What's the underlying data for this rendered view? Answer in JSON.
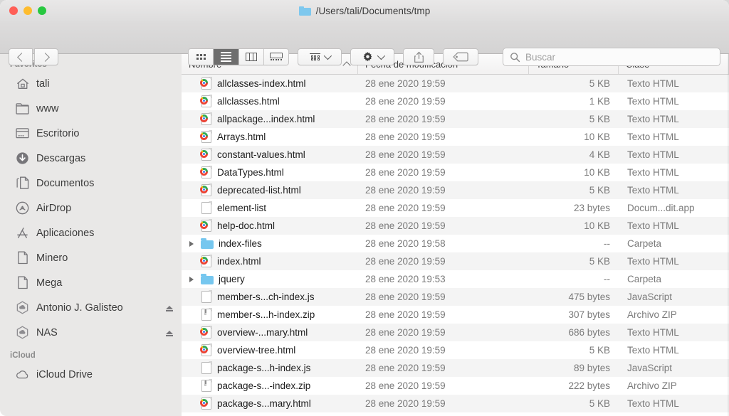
{
  "window": {
    "title": "/Users/tali/Documents/tmp",
    "folder_icon": "folder-icon",
    "traffic_lights": [
      {
        "name": "close-button",
        "color": "#ff5f57"
      },
      {
        "name": "minimize-button",
        "color": "#febc2e"
      },
      {
        "name": "maximize-button",
        "color": "#28c840"
      }
    ]
  },
  "toolbar": {
    "back_icon": "chevron-left-icon",
    "forward_icon": "chevron-right-icon",
    "view_modes": [
      {
        "name": "icon-view",
        "icon": "grid-icon",
        "active": false
      },
      {
        "name": "list-view",
        "icon": "list-icon",
        "active": true
      },
      {
        "name": "column-view",
        "icon": "columns-icon",
        "active": false
      },
      {
        "name": "gallery-view",
        "icon": "gallery-icon",
        "active": false
      }
    ],
    "group_icon": "group-by-icon",
    "action_icon": "gear-icon",
    "share_icon": "share-icon",
    "tag_icon": "tag-icon",
    "dropdown_icon": "chevron-down-icon"
  },
  "search": {
    "icon": "search-icon",
    "placeholder": "Buscar",
    "value": ""
  },
  "sidebar": {
    "sections": [
      {
        "header": "Favoritos",
        "items": [
          {
            "label": "tali",
            "icon": "home-icon",
            "eject": false
          },
          {
            "label": "www",
            "icon": "folder-icon",
            "eject": false
          },
          {
            "label": "Escritorio",
            "icon": "desktop-icon",
            "eject": false
          },
          {
            "label": "Descargas",
            "icon": "download-icon",
            "eject": false
          },
          {
            "label": "Documentos",
            "icon": "documents-icon",
            "eject": false
          },
          {
            "label": "AirDrop",
            "icon": "airdrop-icon",
            "eject": false
          },
          {
            "label": "Aplicaciones",
            "icon": "applications-icon",
            "eject": false
          },
          {
            "label": "Minero",
            "icon": "document-icon",
            "eject": false
          },
          {
            "label": "Mega",
            "icon": "document-icon",
            "eject": false
          },
          {
            "label": "Antonio J. Galisteo",
            "icon": "cloud-drive-icon",
            "eject": true
          },
          {
            "label": "NAS",
            "icon": "cloud-drive-icon",
            "eject": true
          }
        ]
      },
      {
        "header": "iCloud",
        "items": [
          {
            "label": "iCloud Drive",
            "icon": "cloud-icon",
            "eject": false
          }
        ]
      }
    ]
  },
  "filelist": {
    "columns": [
      {
        "label": "Nombre",
        "sorted": true,
        "sort_icon": "sort-ascending-icon"
      },
      {
        "label": "Fecha de modificación",
        "sorted": false,
        "sort_icon": ""
      },
      {
        "label": "Tamaño",
        "sorted": false,
        "sort_icon": ""
      },
      {
        "label": "Clase",
        "sorted": false,
        "sort_icon": ""
      }
    ],
    "rows": [
      {
        "name": "allclasses-index.html",
        "date": "28 ene 2020 19:59",
        "size": "5 KB",
        "kind": "Texto HTML",
        "icon": "html-file-icon",
        "expandable": false
      },
      {
        "name": "allclasses.html",
        "date": "28 ene 2020 19:59",
        "size": "1 KB",
        "kind": "Texto HTML",
        "icon": "html-file-icon",
        "expandable": false
      },
      {
        "name": "allpackage...index.html",
        "date": "28 ene 2020 19:59",
        "size": "5 KB",
        "kind": "Texto HTML",
        "icon": "html-file-icon",
        "expandable": false
      },
      {
        "name": "Arrays.html",
        "date": "28 ene 2020 19:59",
        "size": "10 KB",
        "kind": "Texto HTML",
        "icon": "html-file-icon",
        "expandable": false
      },
      {
        "name": "constant-values.html",
        "date": "28 ene 2020 19:59",
        "size": "4 KB",
        "kind": "Texto HTML",
        "icon": "html-file-icon",
        "expandable": false
      },
      {
        "name": "DataTypes.html",
        "date": "28 ene 2020 19:59",
        "size": "10 KB",
        "kind": "Texto HTML",
        "icon": "html-file-icon",
        "expandable": false
      },
      {
        "name": "deprecated-list.html",
        "date": "28 ene 2020 19:59",
        "size": "5 KB",
        "kind": "Texto HTML",
        "icon": "html-file-icon",
        "expandable": false
      },
      {
        "name": "element-list",
        "date": "28 ene 2020 19:59",
        "size": "23 bytes",
        "kind": "Docum...dit.app",
        "icon": "document-icon",
        "expandable": false
      },
      {
        "name": "help-doc.html",
        "date": "28 ene 2020 19:59",
        "size": "10 KB",
        "kind": "Texto HTML",
        "icon": "html-file-icon",
        "expandable": false
      },
      {
        "name": "index-files",
        "date": "28 ene 2020 19:58",
        "size": "--",
        "kind": "Carpeta",
        "icon": "folder-icon",
        "expandable": true
      },
      {
        "name": "index.html",
        "date": "28 ene 2020 19:59",
        "size": "5 KB",
        "kind": "Texto HTML",
        "icon": "html-file-icon",
        "expandable": false
      },
      {
        "name": "jquery",
        "date": "28 ene 2020 19:53",
        "size": "--",
        "kind": "Carpeta",
        "icon": "folder-icon",
        "expandable": true
      },
      {
        "name": "member-s...ch-index.js",
        "date": "28 ene 2020 19:59",
        "size": "475 bytes",
        "kind": "JavaScript",
        "icon": "document-icon",
        "expandable": false
      },
      {
        "name": "member-s...h-index.zip",
        "date": "28 ene 2020 19:59",
        "size": "307 bytes",
        "kind": "Archivo ZIP",
        "icon": "zip-file-icon",
        "expandable": false
      },
      {
        "name": "overview-...mary.html",
        "date": "28 ene 2020 19:59",
        "size": "686 bytes",
        "kind": "Texto HTML",
        "icon": "html-file-icon",
        "expandable": false
      },
      {
        "name": "overview-tree.html",
        "date": "28 ene 2020 19:59",
        "size": "5 KB",
        "kind": "Texto HTML",
        "icon": "html-file-icon",
        "expandable": false
      },
      {
        "name": "package-s...h-index.js",
        "date": "28 ene 2020 19:59",
        "size": "89 bytes",
        "kind": "JavaScript",
        "icon": "document-icon",
        "expandable": false
      },
      {
        "name": "package-s...-index.zip",
        "date": "28 ene 2020 19:59",
        "size": "222 bytes",
        "kind": "Archivo ZIP",
        "icon": "zip-file-icon",
        "expandable": false
      },
      {
        "name": "package-s...mary.html",
        "date": "28 ene 2020 19:59",
        "size": "5 KB",
        "kind": "Texto HTML",
        "icon": "html-file-icon",
        "expandable": false
      }
    ]
  }
}
